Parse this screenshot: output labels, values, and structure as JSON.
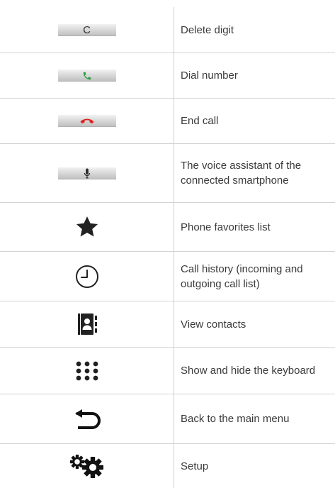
{
  "rows": [
    {
      "icon": "delete-digit-button-icon",
      "glyph": "C",
      "label": "Delete digit"
    },
    {
      "icon": "phone-dial-icon",
      "label": "Dial number",
      "color": "#2ea043"
    },
    {
      "icon": "phone-hangup-icon",
      "label": "End call",
      "color": "#e02020"
    },
    {
      "icon": "microphone-icon",
      "label": "The voice assistant of the connected smartphone"
    },
    {
      "icon": "star-icon",
      "label": "Phone favorites list"
    },
    {
      "icon": "clock-icon",
      "label": "Call history (incoming and outgoing call list)"
    },
    {
      "icon": "contacts-book-icon",
      "label": "View contacts"
    },
    {
      "icon": "keypad-dots-icon",
      "label": "Show and hide the keyboard"
    },
    {
      "icon": "back-arrow-icon",
      "label": "Back to the main menu"
    },
    {
      "icon": "gears-icon",
      "label": "Setup"
    }
  ]
}
